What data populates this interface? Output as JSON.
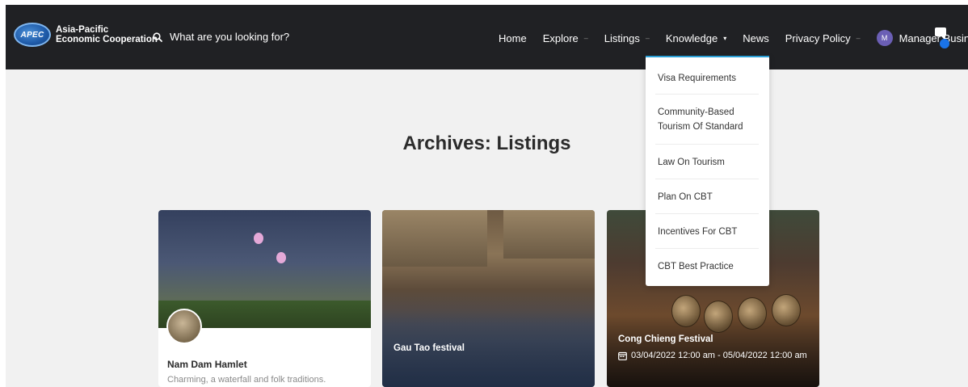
{
  "header": {
    "logo_badge": "APEC",
    "logo_line1": "Asia-Pacific",
    "logo_line2": "Economic Cooperation",
    "search_placeholder": "What are you looking for?",
    "nav": {
      "home": "Home",
      "explore": "Explore",
      "listings": "Listings",
      "knowledge": "Knowledge",
      "news": "News",
      "privacy": "Privacy Policy",
      "user_initial": "M",
      "user_name": "Manager Business"
    },
    "caret_symbol": "▾",
    "caret_closed_symbol": "–"
  },
  "page": {
    "title": "Archives: Listings"
  },
  "dropdown": {
    "items": [
      "Visa Requirements",
      "Community-Based Tourism Of Standard",
      "Law On Tourism",
      "Plan On CBT",
      "Incentives For CBT",
      "CBT Best Practice"
    ]
  },
  "cards": [
    {
      "title": "Nam Dam Hamlet",
      "description": "Charming, a waterfall and folk traditions."
    },
    {
      "title": "Gau Tao festival"
    },
    {
      "title": "Cong Chieng Festival",
      "date": "03/04/2022 12:00 am - 05/04/2022 12:00 am"
    }
  ],
  "colors": {
    "header_bg": "#202124",
    "dropdown_accent": "#2a9fd6",
    "avatar": "#6b5fb5",
    "chat_dot": "#1a73e8"
  }
}
